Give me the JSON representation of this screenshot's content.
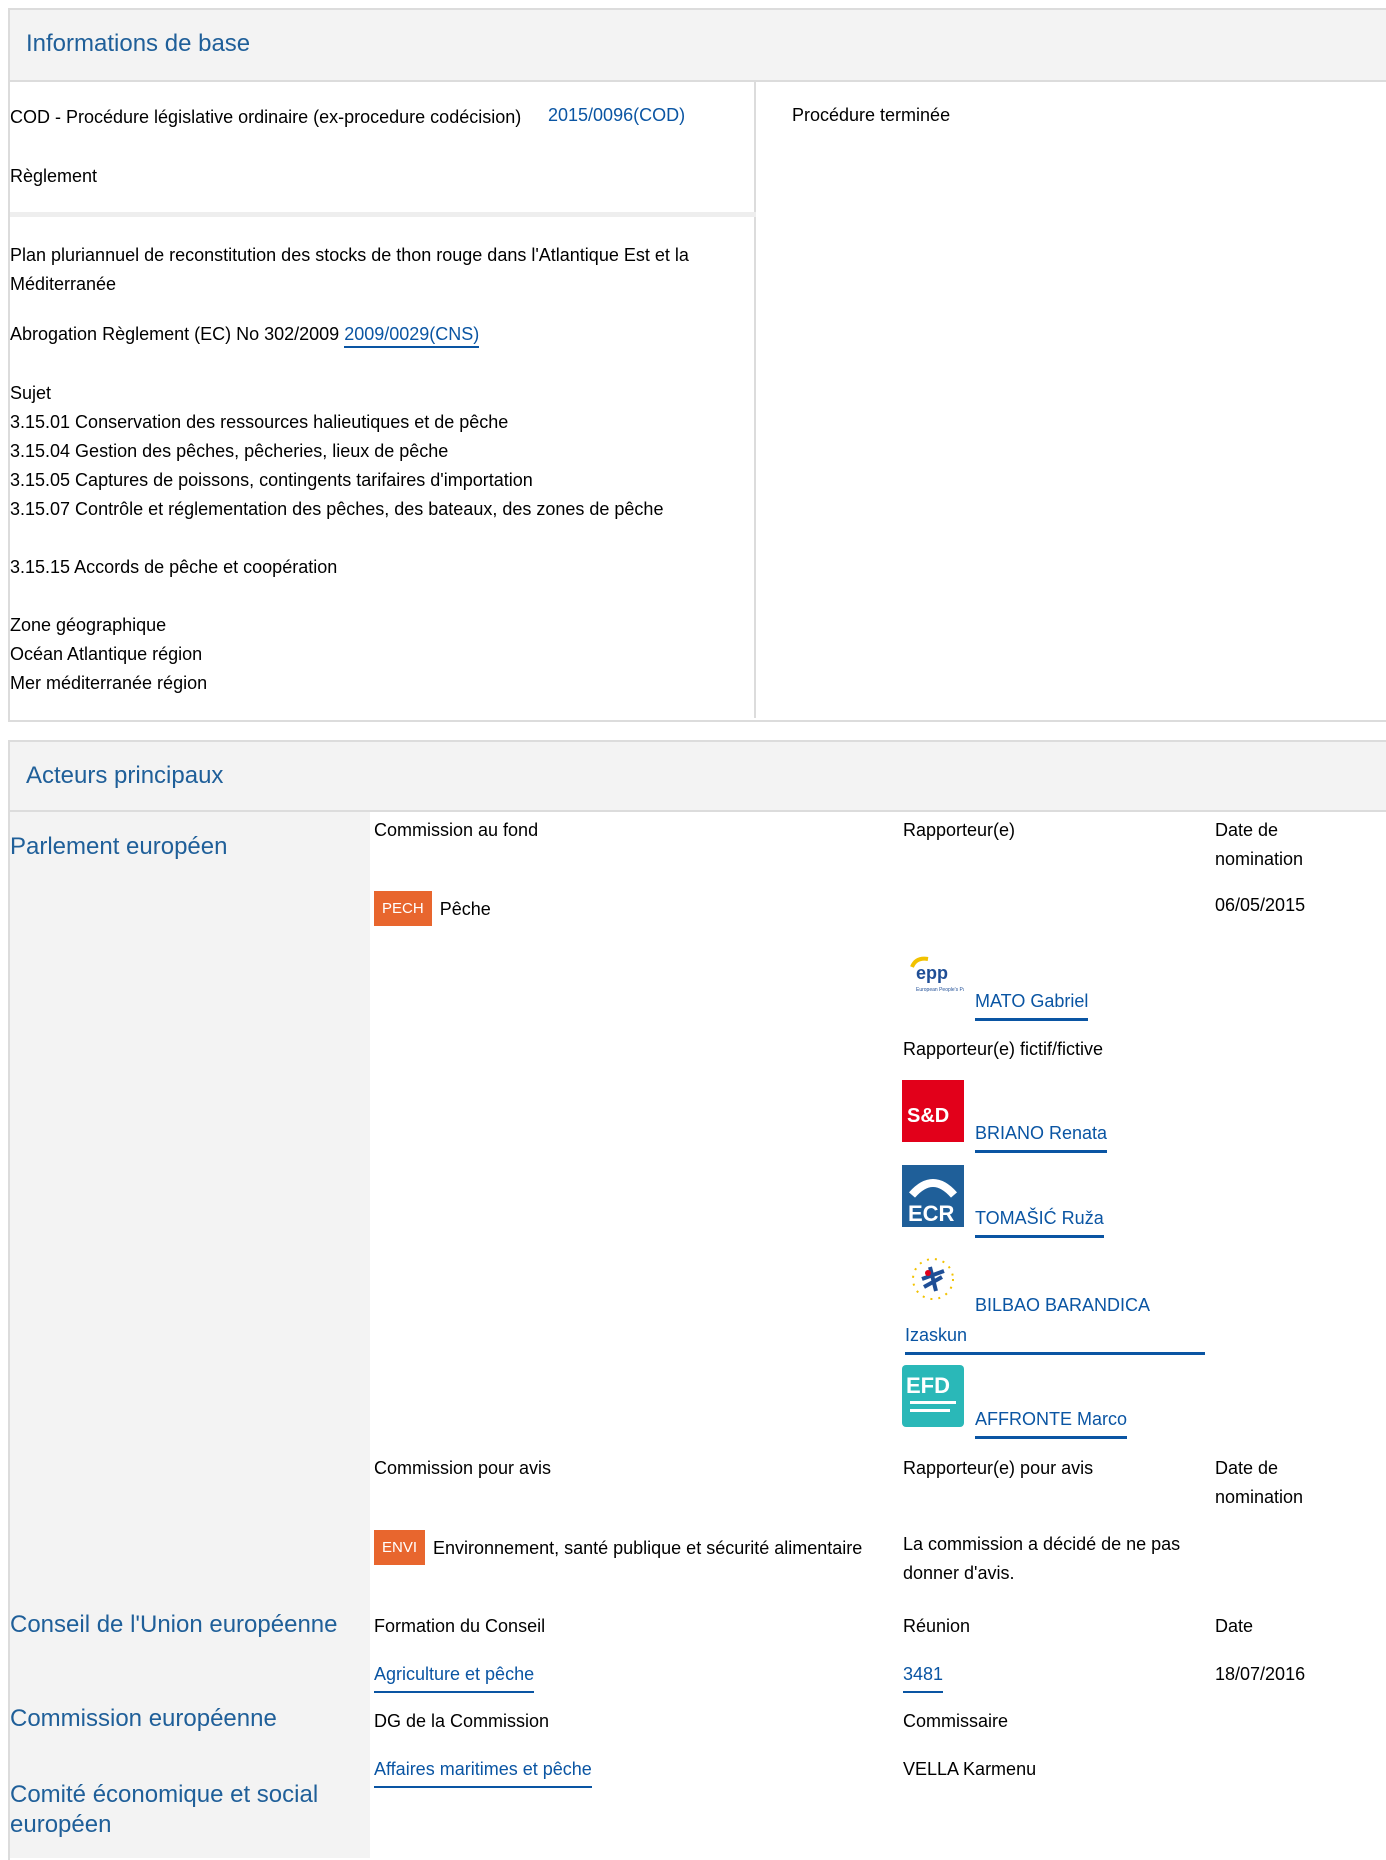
{
  "basic": {
    "header": "Informations de base",
    "procedure_type": "COD - Procédure législative ordinaire (ex-procedure codécision)",
    "instrument": "Règlement",
    "reference": "2015/0096(COD)",
    "status": "Procédure terminée",
    "title": "Plan pluriannuel de reconstitution des stocks de thon rouge dans l'Atlantique Est et la Méditerranée",
    "repeal_text": "Abrogation Règlement (EC) No 302/2009",
    "repeal_link": "2009/0029(CNS)",
    "subject_label": "Sujet",
    "subjects": [
      "3.15.01 Conservation des ressources halieutiques et de pêche",
      "3.15.04 Gestion des pêches, pêcheries, lieux de pêche",
      "3.15.05 Captures de poissons, contingents tarifaires d'importation",
      "3.15.07 Contrôle et réglementation des pêches, des bateaux, des zones de pêche",
      "3.15.15 Accords de pêche et coopération"
    ],
    "geo_label": "Zone géographique",
    "geo": [
      "Océan Atlantique région",
      "Mer méditerranée région"
    ]
  },
  "actors": {
    "header": "Acteurs principaux",
    "parliament": {
      "label": "Parlement européen",
      "col_committee": "Commission au fond",
      "col_rapporteur": "Rapporteur(e)",
      "col_date": "Date de nomination",
      "committee_tag": "PECH",
      "committee_name": "Pêche",
      "date": "06/05/2015",
      "rapporteur": "MATO Gabriel",
      "rapporteur_logo": "epp",
      "shadow_label": "Rapporteur(e) fictif/fictive",
      "shadows": [
        {
          "name": "BRIANO Renata",
          "logo": "S&D"
        },
        {
          "name": "TOMAŠIĆ Ruža",
          "logo": "ECR"
        },
        {
          "name": "BILBAO BARANDICA Izaskun",
          "logo": "ALDE"
        },
        {
          "name": "AFFRONTE Marco",
          "logo": "EFD"
        }
      ],
      "col_opinion": "Commission pour avis",
      "col_opinion_rapporteur": "Rapporteur(e) pour avis",
      "col_opinion_date": "Date de nomination",
      "opinion_tag": "ENVI",
      "opinion_name": "Environnement, santé publique et sécurité alimentaire",
      "opinion_note": "La commission a décidé de ne pas donner d'avis."
    },
    "council": {
      "label": "Conseil de l'Union européenne",
      "col_formation": "Formation du Conseil",
      "col_meeting": "Réunion",
      "col_date": "Date",
      "formation": "Agriculture et pêche",
      "meeting": "3481",
      "date": "18/07/2016"
    },
    "commission": {
      "label": "Commission européenne",
      "col_dg": "DG de la Commission",
      "col_commissioner": "Commissaire",
      "dg": "Affaires maritimes et pêche",
      "commissioner": "VELLA Karmenu"
    },
    "eesc": {
      "label": "Comité économique et social européen"
    }
  }
}
